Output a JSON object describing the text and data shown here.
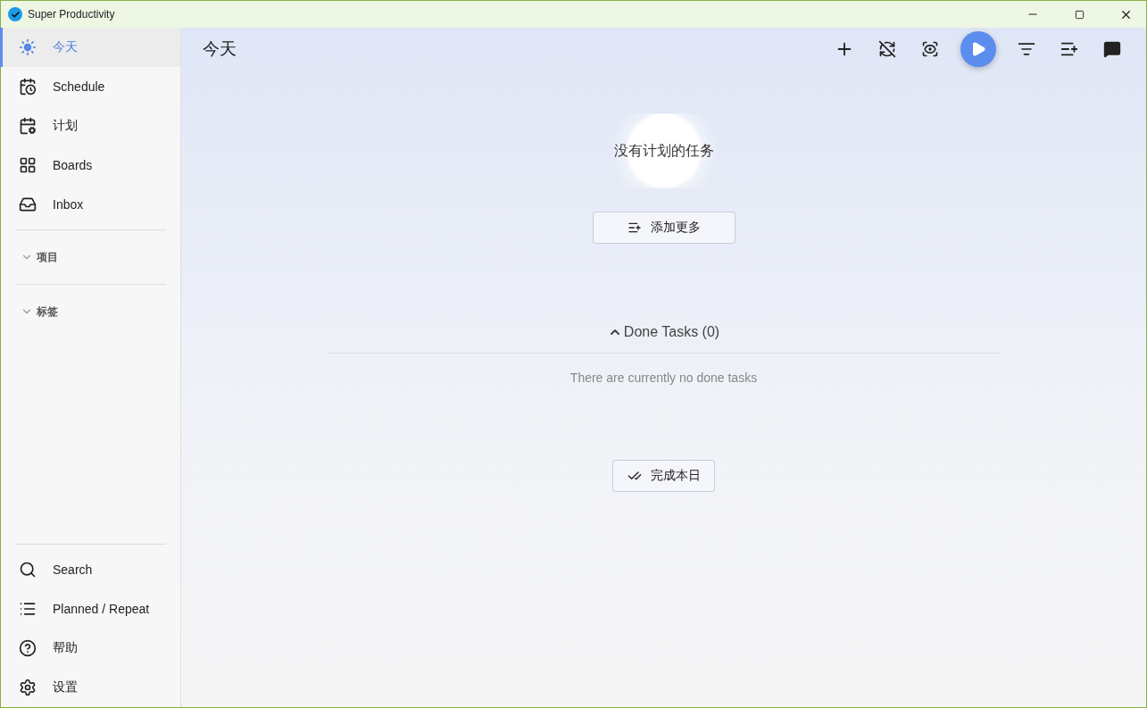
{
  "window": {
    "title": "Super Productivity"
  },
  "sidebar": {
    "items": [
      {
        "label": "今天",
        "selected": true
      },
      {
        "label": "Schedule",
        "selected": false
      },
      {
        "label": "计划",
        "selected": false
      },
      {
        "label": "Boards",
        "selected": false
      },
      {
        "label": "Inbox",
        "selected": false
      }
    ],
    "sections": [
      {
        "label": "项目",
        "expanded": false
      },
      {
        "label": "标签",
        "expanded": false
      }
    ],
    "bottom_items": [
      {
        "label": "Search"
      },
      {
        "label": "Planned / Repeat"
      },
      {
        "label": "帮助"
      },
      {
        "label": "设置"
      }
    ]
  },
  "header": {
    "title": "今天"
  },
  "empty_state": {
    "message": "没有计划的任务",
    "add_button": "添加更多"
  },
  "done_tasks": {
    "title": "Done Tasks (0)",
    "expanded": true,
    "empty_text": "There are currently no done tasks"
  },
  "finish_button": "完成本日"
}
